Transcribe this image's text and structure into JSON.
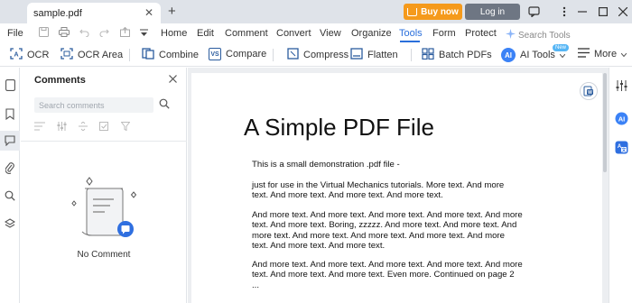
{
  "titlebar": {
    "tab_label": "sample.pdf",
    "tab_close": "✕",
    "new_tab": "+",
    "buy_label": "Buy now",
    "login_label": "Log in"
  },
  "menu": {
    "file": "File",
    "items": [
      "Home",
      "Edit",
      "Comment",
      "Convert",
      "View",
      "Organize",
      "Tools",
      "Form",
      "Protect"
    ],
    "active": "Tools",
    "search_placeholder": "Search Tools"
  },
  "toolbar": {
    "ocr": "OCR",
    "ocr_area": "OCR Area",
    "combine": "Combine",
    "compare": "Compare",
    "compress": "Compress",
    "flatten": "Flatten",
    "batch": "Batch PDFs",
    "ai_tools": "AI Tools",
    "ai_badge": "AI",
    "new_badge": "New",
    "more": "More"
  },
  "panel": {
    "title": "Comments",
    "search_placeholder": "Search comments",
    "empty_text": "No Comment"
  },
  "document": {
    "title": "A Simple PDF File",
    "paragraphs": [
      "This is a small demonstration .pdf file -",
      "just for use in the Virtual Mechanics tutorials. More text. And more text. And more text. And more text. And more text.",
      "And more text. And more text. And more text. And more text. And more text. And more text. Boring, zzzzz. And more text. And more text. And more text. And more text. And more text. And more text. And more text. And more text. And more text.",
      "And more text. And more text. And more text. And more text. And more text. And more text. And more text. Even more. Continued on page 2 ..."
    ]
  },
  "colors": {
    "accent": "#2a6fdb",
    "buy": "#f59a1c",
    "login": "#6e7683"
  }
}
